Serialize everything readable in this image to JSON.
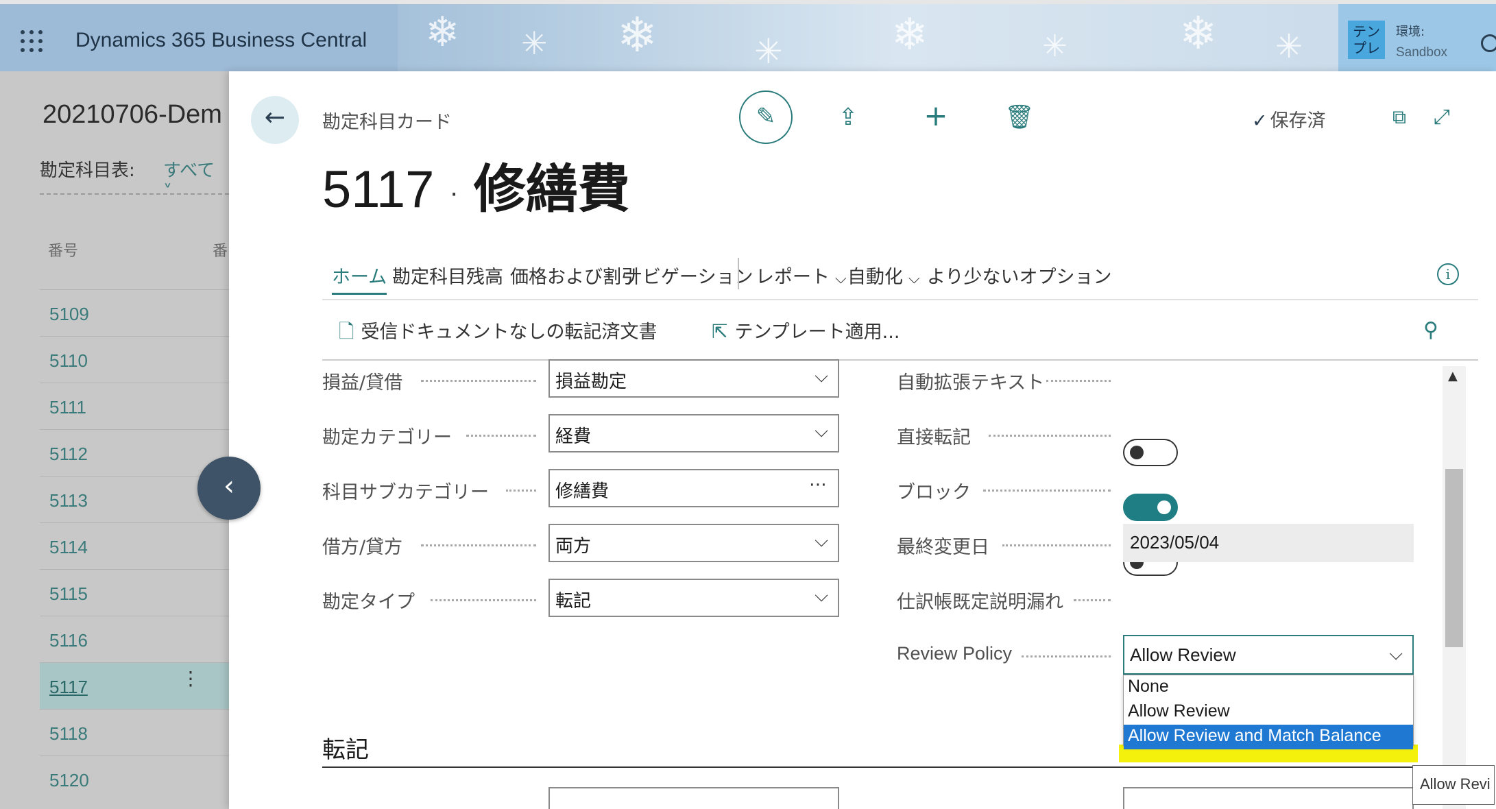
{
  "topbar": {
    "app_title": "Dynamics 365 Business Central",
    "env_badge": "テン\nプレ",
    "env_label": "環境:",
    "env_name": "Sandbox"
  },
  "list_page": {
    "title": "20210706-Dem",
    "filter_label": "勘定科目表:",
    "filter_value": "すべて ˅",
    "col_no": "番号",
    "col_no2": "番",
    "rows": [
      "5109",
      "5110",
      "5111",
      "5112",
      "5113",
      "5114",
      "5115",
      "5116",
      "5117",
      "5118",
      "5120"
    ],
    "selected_row": "5117"
  },
  "card": {
    "breadcrumb": "勘定科目カード",
    "saved_label": "保存済",
    "number": "5117",
    "name": "修繕費",
    "actions": [
      "ホーム",
      "勘定科目",
      "残高",
      "価格および割引",
      "ナビゲーション",
      "レポート",
      "自動化",
      "より少ないオプション"
    ],
    "active_action": "ホーム",
    "subactions": [
      "受信ドキュメントなしの転記済文書",
      "テンプレート適用..."
    ],
    "left_fields": [
      {
        "label": "損益/貸借",
        "value": "損益勘定"
      },
      {
        "label": "勘定カテゴリー",
        "value": "経費"
      },
      {
        "label": "科目サブカテゴリー",
        "value": "修繕費"
      },
      {
        "label": "借方/貸方",
        "value": "両方"
      },
      {
        "label": "勘定タイプ",
        "value": "転記"
      }
    ],
    "right_fields": [
      {
        "label": "自動拡張テキスト",
        "on": false
      },
      {
        "label": "直接転記",
        "on": true
      },
      {
        "label": "ブロック",
        "on": false
      },
      {
        "label": "最終変更日",
        "value": "2023/05/04"
      },
      {
        "label": "仕訳帳既定説明漏れ",
        "on": false
      }
    ],
    "review_policy": {
      "label": "Review Policy",
      "value": "Allow Review",
      "options": [
        "None",
        "Allow Review",
        "Allow Review and Match Balance"
      ],
      "highlighted_option": "Allow Review and Match Balance"
    },
    "section_title": "転記",
    "tooltip": "Allow Revi"
  }
}
